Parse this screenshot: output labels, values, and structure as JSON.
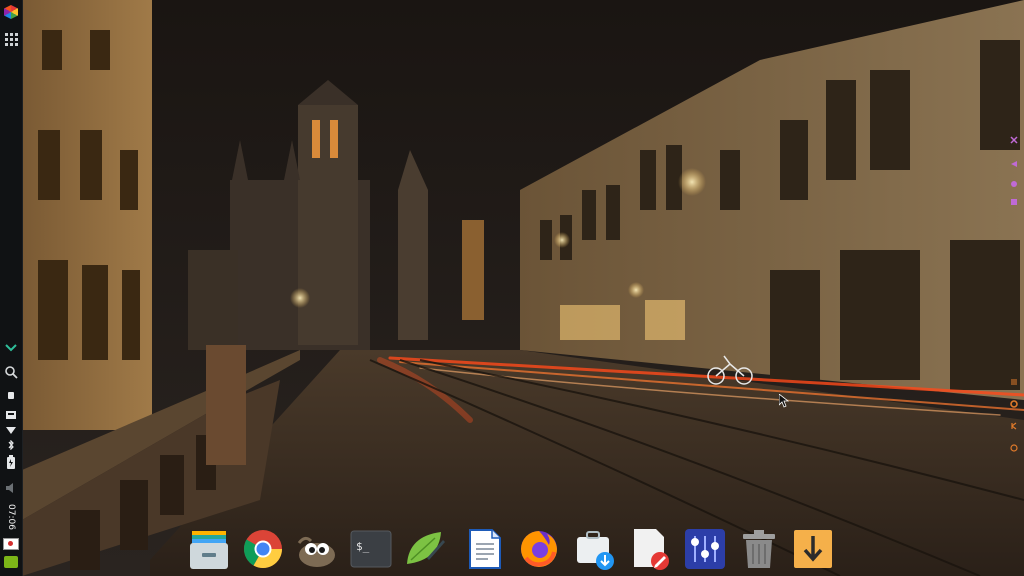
{
  "panel": {
    "clock": "07:06",
    "tray_icons": [
      "app-menu-icon",
      "grid-icon",
      "chevron-down-icon",
      "search-icon",
      "usb-icon",
      "network-icon",
      "bluetooth-icon",
      "battery-icon",
      "volume-icon",
      "flag-icon",
      "keyboard-layout-icon"
    ]
  },
  "dock": {
    "items": [
      "file-manager-icon",
      "chrome-icon",
      "gimp-icon",
      "terminal-icon",
      "text-editor-icon",
      "document-viewer-icon",
      "firefox-icon",
      "software-installer-icon",
      "file-editor-icon",
      "mixer-icon",
      "trash-icon",
      "downloads-icon"
    ],
    "terminal_glyph": "$_"
  },
  "colors": {
    "panel_bg": "#101214",
    "accent": "#2fbf9b",
    "edge_widgets": "#c06ad6"
  }
}
